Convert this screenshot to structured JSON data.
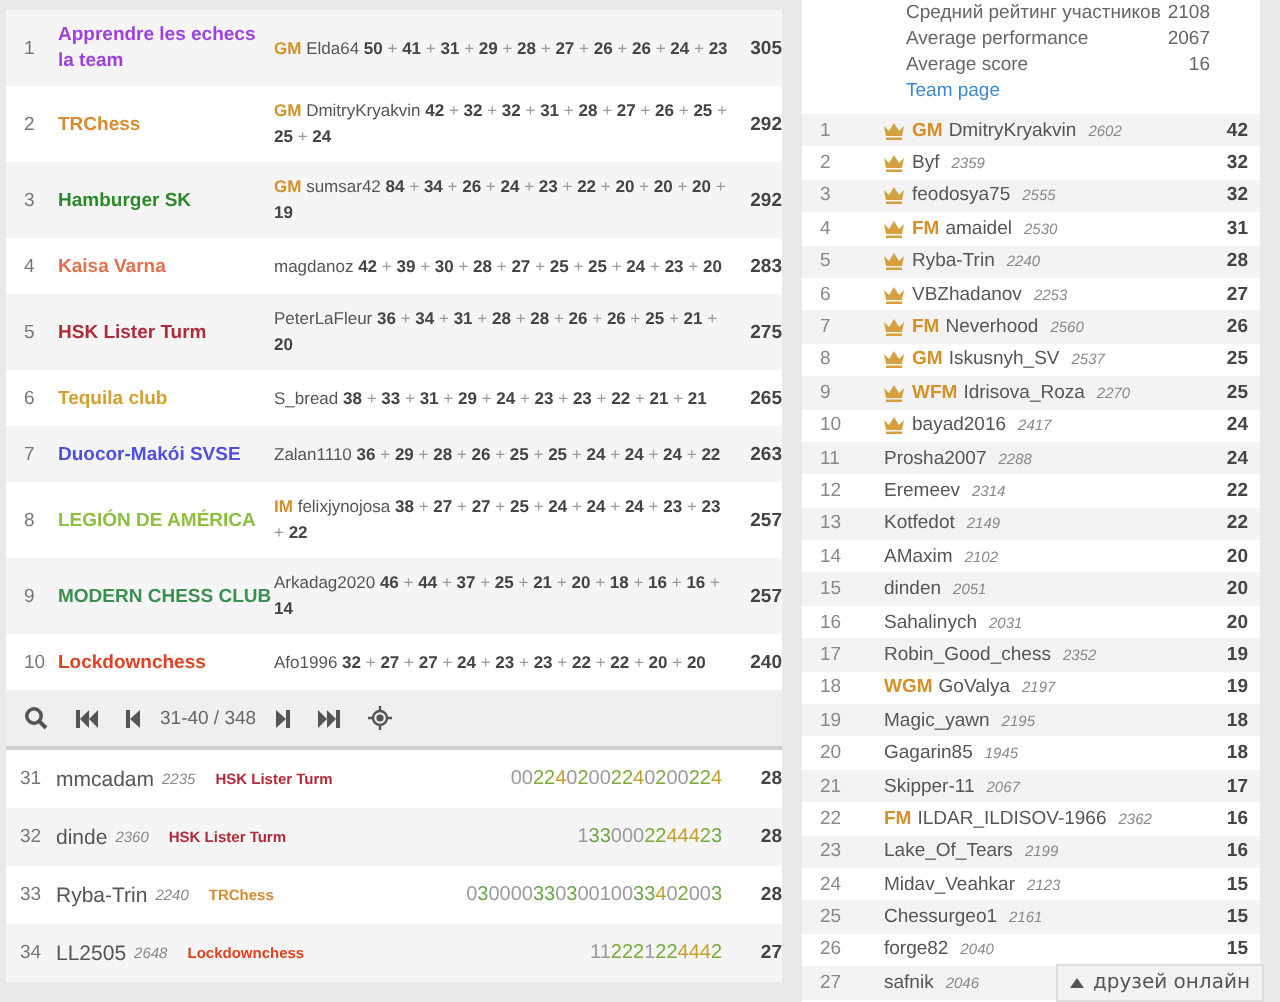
{
  "teams": [
    {
      "rank": "1",
      "name": "Apprendre les echecs la team",
      "color": "#a040e0",
      "leader": {
        "title": "GM",
        "name": "Elda64"
      },
      "scores": "**50** + **41** + **31** + **29** + **28** + **27** + **26** + **26** + **24** + **23**",
      "total": "305"
    },
    {
      "rank": "2",
      "name": "TRChess",
      "color": "#d88a30",
      "leader": {
        "title": "GM",
        "name": "DmitryKryakvin"
      },
      "scores": "**42** + **32** + **32** + **31** + **28** + **27** + **26** + **25** + **25** + **24**",
      "total": "292"
    },
    {
      "rank": "3",
      "name": "Hamburger SK",
      "color": "#2a8a2a",
      "leader": {
        "title": "GM",
        "name": "sumsar42"
      },
      "scores": "**84** + **34** + **26** + **24** + **23** + **22** + **20** + **20** + **20** + **19**",
      "total": "292"
    },
    {
      "rank": "4",
      "name": "Kaisa Varna",
      "color": "#e07050",
      "leader": {
        "name": "magdanoz"
      },
      "scores": "**42** + **39** + **30** + **28** + **27** + **25** + **25** + **24** + **23** + **20**",
      "total": "283"
    },
    {
      "rank": "5",
      "name": "HSK Lister Turm",
      "color": "#b02c38",
      "leader": {
        "name": "PeterLaFleur"
      },
      "scores": "**36** + **34** + **31** + **28** + **28** + **26** + **26** + **25** + **21** + **20**",
      "total": "275"
    },
    {
      "rank": "6",
      "name": "Tequila club",
      "color": "#d4a030",
      "leader": {
        "name": "S_bread"
      },
      "scores": "**38** + **33** + **31** + **29** + **24** + **23** + **23** + **22** + **21** + **21**",
      "total": "265"
    },
    {
      "rank": "7",
      "name": "Duocor-Makói SVSE",
      "color": "#5050e0",
      "leader": {
        "name": "Zalan1110"
      },
      "scores": "**36** + **29** + **28** + **26** + **25** + **25** + **24** + **24** + **24** + **22**",
      "total": "263"
    },
    {
      "rank": "8",
      "name": "LEGIÓN DE AMÉRICA",
      "color": "#8cc040",
      "leader": {
        "title": "IM",
        "name": "felixjynojosa"
      },
      "scores": "**38** + **27** + **27** + **25** + **24** + **24** + **24** + **23** + **23** + **22**",
      "total": "257"
    },
    {
      "rank": "9",
      "name": "MODERN CHESS CLUB",
      "color": "#3a9050",
      "leader": {
        "name": "Arkadag2020"
      },
      "scores": "**46** + **44** + **37** + **25** + **21** + **20** + **18** + **16** + **16** + **14**",
      "total": "257"
    },
    {
      "rank": "10",
      "name": "Lockdownchess",
      "color": "#e04020",
      "leader": {
        "name": "Afo1996"
      },
      "scores": "**32** + **27** + **27** + **24** + **23** + **23** + **22** + **22** + **20** + **20**",
      "total": "240"
    }
  ],
  "pager": {
    "range": "31-40 / 348"
  },
  "players": [
    {
      "rank": "31",
      "name": "mmcadam",
      "rating": "2235",
      "team": "HSK Lister Turm",
      "color": "#b02c38",
      "results": "0022402002240200224",
      "score": "28"
    },
    {
      "rank": "32",
      "name": "dinde",
      "rating": "2360",
      "team": "HSK Lister Turm",
      "color": "#b02c38",
      "results": "1330002244423",
      "score": "28"
    },
    {
      "rank": "33",
      "name": "Ryba-Trin",
      "rating": "2240",
      "team": "TRChess",
      "color": "#d88a30",
      "results": "03000033030010033402003",
      "score": "28"
    },
    {
      "rank": "34",
      "name": "LL2505",
      "rating": "2648",
      "team": "Lockdownchess",
      "color": "#e04020",
      "results": "112221224442",
      "score": "27"
    }
  ],
  "team_info": {
    "stats": [
      {
        "label": "Средний рейтинг участников",
        "value": "2108"
      },
      {
        "label": "Average performance",
        "value": "2067"
      },
      {
        "label": "Average score",
        "value": "16"
      }
    ],
    "link": "Team page"
  },
  "members": [
    {
      "rank": "1",
      "crown": true,
      "title": "GM",
      "name": "DmitryKryakvin",
      "rating": "2602",
      "score": "42"
    },
    {
      "rank": "2",
      "crown": true,
      "name": "Byf",
      "rating": "2359",
      "score": "32"
    },
    {
      "rank": "3",
      "crown": true,
      "name": "feodosya75",
      "rating": "2555",
      "score": "32"
    },
    {
      "rank": "4",
      "crown": true,
      "title": "FM",
      "name": "amaidel",
      "rating": "2530",
      "score": "31"
    },
    {
      "rank": "5",
      "crown": true,
      "name": "Ryba-Trin",
      "rating": "2240",
      "score": "28"
    },
    {
      "rank": "6",
      "crown": true,
      "name": "VBZhadanov",
      "rating": "2253",
      "score": "27"
    },
    {
      "rank": "7",
      "crown": true,
      "title": "FM",
      "name": "Neverhood",
      "rating": "2560",
      "score": "26"
    },
    {
      "rank": "8",
      "crown": true,
      "title": "GM",
      "name": "Iskusnyh_SV",
      "rating": "2537",
      "score": "25"
    },
    {
      "rank": "9",
      "crown": true,
      "title": "WFM",
      "name": "Idrisova_Roza",
      "rating": "2270",
      "score": "25"
    },
    {
      "rank": "10",
      "crown": true,
      "name": "bayad2016",
      "rating": "2417",
      "score": "24"
    },
    {
      "rank": "11",
      "crown": false,
      "name": "Prosha2007",
      "rating": "2288",
      "score": "24"
    },
    {
      "rank": "12",
      "crown": false,
      "name": "Eremeev",
      "rating": "2314",
      "score": "22"
    },
    {
      "rank": "13",
      "crown": false,
      "name": "Kotfedot",
      "rating": "2149",
      "score": "22"
    },
    {
      "rank": "14",
      "crown": false,
      "name": "AMaxim",
      "rating": "2102",
      "score": "20"
    },
    {
      "rank": "15",
      "crown": false,
      "name": "dinden",
      "rating": "2051",
      "score": "20"
    },
    {
      "rank": "16",
      "crown": false,
      "name": "Sahalinych",
      "rating": "2031",
      "score": "20"
    },
    {
      "rank": "17",
      "crown": false,
      "name": "Robin_Good_chess",
      "rating": "2352",
      "score": "19"
    },
    {
      "rank": "18",
      "crown": false,
      "title": "WGM",
      "name": "GoValya",
      "rating": "2197",
      "score": "19"
    },
    {
      "rank": "19",
      "crown": false,
      "name": "Magic_yawn",
      "rating": "2195",
      "score": "18"
    },
    {
      "rank": "20",
      "crown": false,
      "name": "Gagarin85",
      "rating": "1945",
      "score": "18"
    },
    {
      "rank": "21",
      "crown": false,
      "name": "Skipper-11",
      "rating": "2067",
      "score": "17"
    },
    {
      "rank": "22",
      "crown": false,
      "title": "FM",
      "name": "ILDAR_ILDISOV-1966",
      "rating": "2362",
      "score": "16"
    },
    {
      "rank": "23",
      "crown": false,
      "name": "Lake_Of_Tears",
      "rating": "2199",
      "score": "16"
    },
    {
      "rank": "24",
      "crown": false,
      "name": "Midav_Veahkar",
      "rating": "2123",
      "score": "15"
    },
    {
      "rank": "25",
      "crown": false,
      "name": "Chessurgeo1",
      "rating": "2161",
      "score": "15"
    },
    {
      "rank": "26",
      "crown": false,
      "name": "forge82",
      "rating": "2040",
      "score": "15"
    },
    {
      "rank": "27",
      "crown": false,
      "name": "safnik",
      "rating": "2046"
    }
  ],
  "friends_button": {
    "label": "друзей онлайн"
  }
}
